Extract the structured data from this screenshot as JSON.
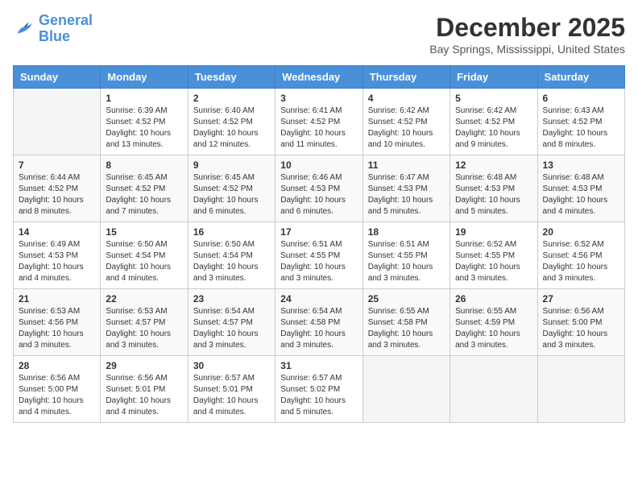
{
  "header": {
    "logo_line1": "General",
    "logo_line2": "Blue",
    "title": "December 2025",
    "subtitle": "Bay Springs, Mississippi, United States"
  },
  "days_of_week": [
    "Sunday",
    "Monday",
    "Tuesday",
    "Wednesday",
    "Thursday",
    "Friday",
    "Saturday"
  ],
  "weeks": [
    [
      {
        "day": "",
        "info": ""
      },
      {
        "day": "1",
        "info": "Sunrise: 6:39 AM\nSunset: 4:52 PM\nDaylight: 10 hours\nand 13 minutes."
      },
      {
        "day": "2",
        "info": "Sunrise: 6:40 AM\nSunset: 4:52 PM\nDaylight: 10 hours\nand 12 minutes."
      },
      {
        "day": "3",
        "info": "Sunrise: 6:41 AM\nSunset: 4:52 PM\nDaylight: 10 hours\nand 11 minutes."
      },
      {
        "day": "4",
        "info": "Sunrise: 6:42 AM\nSunset: 4:52 PM\nDaylight: 10 hours\nand 10 minutes."
      },
      {
        "day": "5",
        "info": "Sunrise: 6:42 AM\nSunset: 4:52 PM\nDaylight: 10 hours\nand 9 minutes."
      },
      {
        "day": "6",
        "info": "Sunrise: 6:43 AM\nSunset: 4:52 PM\nDaylight: 10 hours\nand 8 minutes."
      }
    ],
    [
      {
        "day": "7",
        "info": "Sunrise: 6:44 AM\nSunset: 4:52 PM\nDaylight: 10 hours\nand 8 minutes."
      },
      {
        "day": "8",
        "info": "Sunrise: 6:45 AM\nSunset: 4:52 PM\nDaylight: 10 hours\nand 7 minutes."
      },
      {
        "day": "9",
        "info": "Sunrise: 6:45 AM\nSunset: 4:52 PM\nDaylight: 10 hours\nand 6 minutes."
      },
      {
        "day": "10",
        "info": "Sunrise: 6:46 AM\nSunset: 4:53 PM\nDaylight: 10 hours\nand 6 minutes."
      },
      {
        "day": "11",
        "info": "Sunrise: 6:47 AM\nSunset: 4:53 PM\nDaylight: 10 hours\nand 5 minutes."
      },
      {
        "day": "12",
        "info": "Sunrise: 6:48 AM\nSunset: 4:53 PM\nDaylight: 10 hours\nand 5 minutes."
      },
      {
        "day": "13",
        "info": "Sunrise: 6:48 AM\nSunset: 4:53 PM\nDaylight: 10 hours\nand 4 minutes."
      }
    ],
    [
      {
        "day": "14",
        "info": "Sunrise: 6:49 AM\nSunset: 4:53 PM\nDaylight: 10 hours\nand 4 minutes."
      },
      {
        "day": "15",
        "info": "Sunrise: 6:50 AM\nSunset: 4:54 PM\nDaylight: 10 hours\nand 4 minutes."
      },
      {
        "day": "16",
        "info": "Sunrise: 6:50 AM\nSunset: 4:54 PM\nDaylight: 10 hours\nand 3 minutes."
      },
      {
        "day": "17",
        "info": "Sunrise: 6:51 AM\nSunset: 4:55 PM\nDaylight: 10 hours\nand 3 minutes."
      },
      {
        "day": "18",
        "info": "Sunrise: 6:51 AM\nSunset: 4:55 PM\nDaylight: 10 hours\nand 3 minutes."
      },
      {
        "day": "19",
        "info": "Sunrise: 6:52 AM\nSunset: 4:55 PM\nDaylight: 10 hours\nand 3 minutes."
      },
      {
        "day": "20",
        "info": "Sunrise: 6:52 AM\nSunset: 4:56 PM\nDaylight: 10 hours\nand 3 minutes."
      }
    ],
    [
      {
        "day": "21",
        "info": "Sunrise: 6:53 AM\nSunset: 4:56 PM\nDaylight: 10 hours\nand 3 minutes."
      },
      {
        "day": "22",
        "info": "Sunrise: 6:53 AM\nSunset: 4:57 PM\nDaylight: 10 hours\nand 3 minutes."
      },
      {
        "day": "23",
        "info": "Sunrise: 6:54 AM\nSunset: 4:57 PM\nDaylight: 10 hours\nand 3 minutes."
      },
      {
        "day": "24",
        "info": "Sunrise: 6:54 AM\nSunset: 4:58 PM\nDaylight: 10 hours\nand 3 minutes."
      },
      {
        "day": "25",
        "info": "Sunrise: 6:55 AM\nSunset: 4:58 PM\nDaylight: 10 hours\nand 3 minutes."
      },
      {
        "day": "26",
        "info": "Sunrise: 6:55 AM\nSunset: 4:59 PM\nDaylight: 10 hours\nand 3 minutes."
      },
      {
        "day": "27",
        "info": "Sunrise: 6:56 AM\nSunset: 5:00 PM\nDaylight: 10 hours\nand 3 minutes."
      }
    ],
    [
      {
        "day": "28",
        "info": "Sunrise: 6:56 AM\nSunset: 5:00 PM\nDaylight: 10 hours\nand 4 minutes."
      },
      {
        "day": "29",
        "info": "Sunrise: 6:56 AM\nSunset: 5:01 PM\nDaylight: 10 hours\nand 4 minutes."
      },
      {
        "day": "30",
        "info": "Sunrise: 6:57 AM\nSunset: 5:01 PM\nDaylight: 10 hours\nand 4 minutes."
      },
      {
        "day": "31",
        "info": "Sunrise: 6:57 AM\nSunset: 5:02 PM\nDaylight: 10 hours\nand 5 minutes."
      },
      {
        "day": "",
        "info": ""
      },
      {
        "day": "",
        "info": ""
      },
      {
        "day": "",
        "info": ""
      }
    ]
  ]
}
